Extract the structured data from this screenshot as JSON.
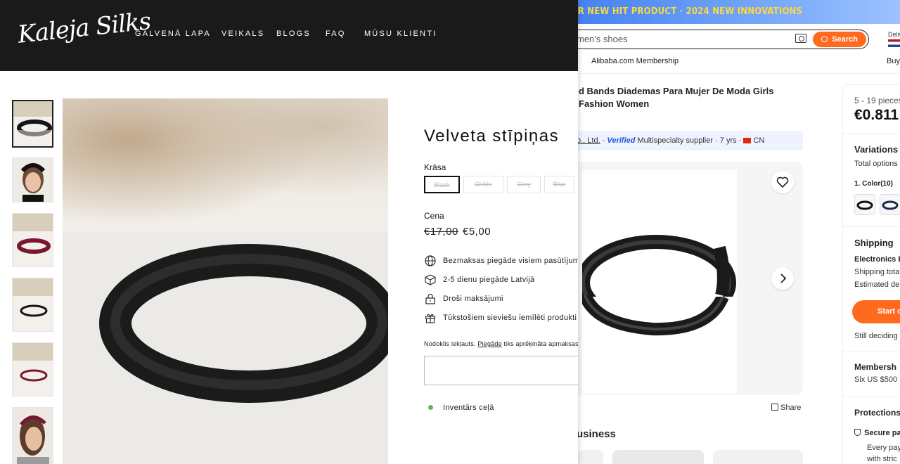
{
  "alibaba": {
    "banner_text": "UR NEW HIT PRODUCT · 2024 NEW INNOVATIONS",
    "search_text": "men's shoes",
    "search_button": "Search",
    "deliver_label": "Deliv",
    "membership_link": "Alibaba.com Membership",
    "buyer_link": "Buy",
    "product_title": "d Bands Diademas Para Mujer De Moda Girls Fashion Women",
    "supplier_name": "o., Ltd.",
    "verified": "Verified",
    "supplier_info": "Multispecialty supplier · 7 yrs ·",
    "country": "CN",
    "share": "Share",
    "business_heading": "usiness",
    "side": {
      "price_range": "5 - 19 pieces",
      "price": "€0.811",
      "variations": "Variations",
      "total_options": "Total options",
      "color_label": "1. Color(10)",
      "shipping": "Shipping",
      "electronics": "Electronics E",
      "shipping_total": "Shipping tota",
      "estimated": "Estimated de",
      "start_button": "Start o",
      "still_deciding": "Still deciding",
      "membership": "Membersh",
      "six_us": "Six US $500",
      "protections": "Protections",
      "secure": "Secure pa",
      "every": "Every pay",
      "with": "with stric"
    },
    "accent": "#ff6a1f"
  },
  "kaleja": {
    "logo": "Kaleja Silks",
    "nav": [
      "GALVENĀ LAPA",
      "VEIKALS",
      "BLOGS",
      "FAQ",
      "MŪSU KLIENTI"
    ],
    "product_title": "Velveta stīpiņas",
    "color_label": "Krāsa",
    "swatches": [
      "Black",
      "Chillie",
      "Grey",
      "Blue"
    ],
    "price_label": "Cena",
    "old_price": "€17,00",
    "new_price": "€5,00",
    "features": [
      "Bezmaksas piegāde visiem pasūtījumiem",
      "2-5 dienu piegāde Latvijā",
      "Droši maksājumi",
      "Tūkstošiem sieviešu iemīlēti produkti"
    ],
    "tax_before": "Nodoklis iekļauts.",
    "tax_link": "Piegāde",
    "tax_after": "tiks aprēķināta apmaksas",
    "inventory": "Inventārs ceļā",
    "inventory_color": "#5cb85c"
  }
}
